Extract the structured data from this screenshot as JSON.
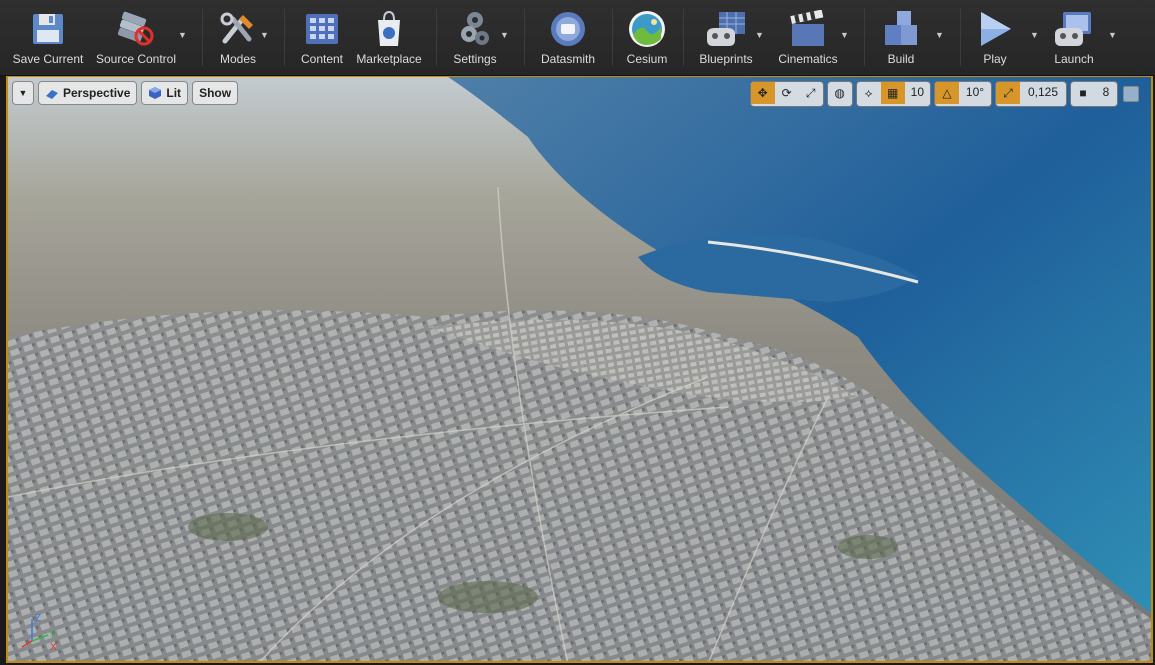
{
  "toolbar": {
    "buttons": [
      {
        "label": "Save Current",
        "icon": "floppy-disk-icon"
      },
      {
        "label": "Source Control",
        "icon": "source-control-icon"
      },
      {
        "label": "Modes",
        "icon": "modes-icon"
      },
      {
        "label": "Content",
        "icon": "content-grid-icon"
      },
      {
        "label": "Marketplace",
        "icon": "marketplace-bag-icon"
      },
      {
        "label": "Settings",
        "icon": "settings-gears-icon"
      },
      {
        "label": "Datasmith",
        "icon": "datasmith-icon"
      },
      {
        "label": "Cesium",
        "icon": "cesium-icon"
      },
      {
        "label": "Blueprints",
        "icon": "blueprints-icon"
      },
      {
        "label": "Cinematics",
        "icon": "clapperboard-icon"
      },
      {
        "label": "Build",
        "icon": "build-blocks-icon"
      },
      {
        "label": "Play",
        "icon": "play-icon"
      },
      {
        "label": "Launch",
        "icon": "launch-icon"
      }
    ]
  },
  "viewport": {
    "perspective_label": "Perspective",
    "lit_label": "Lit",
    "show_label": "Show",
    "grid_snap_value": "10",
    "rotation_snap_value": "10°",
    "scale_snap_value": "0,125",
    "camera_speed_value": "8",
    "axis": {
      "z": "Z",
      "y": "Y",
      "x": "X"
    },
    "colors": {
      "selection_border": "#c58b0f",
      "active_toggle": "#d7962a"
    }
  }
}
